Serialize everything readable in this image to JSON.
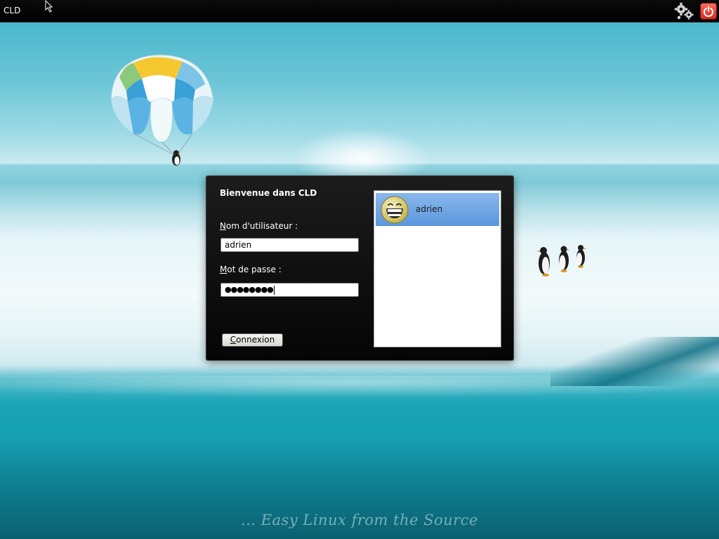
{
  "topbar": {
    "title": "CLD",
    "settings_icon": "gear-icon",
    "power_icon": "power-icon"
  },
  "dialog": {
    "welcome": "Bienvenue dans CLD",
    "username_label_mnemonic": "N",
    "username_label_rest": "om d'utilisateur :",
    "username_value": "adrien",
    "password_label_mnemonic": "M",
    "password_label_rest": "ot de passe :",
    "password_masked": "●●●●●●●●",
    "login_button_mnemonic": "C",
    "login_button_rest": "onnexion"
  },
  "user_list": {
    "items": [
      {
        "name": "adrien",
        "avatar": "smiley-avatar-icon",
        "selected": true
      }
    ]
  },
  "wallpaper": {
    "tagline": "... Easy Linux from the Source"
  },
  "colors": {
    "selection": "#6fa6e4",
    "power_button": "#e0392c",
    "dialog_bg": "#111111"
  }
}
